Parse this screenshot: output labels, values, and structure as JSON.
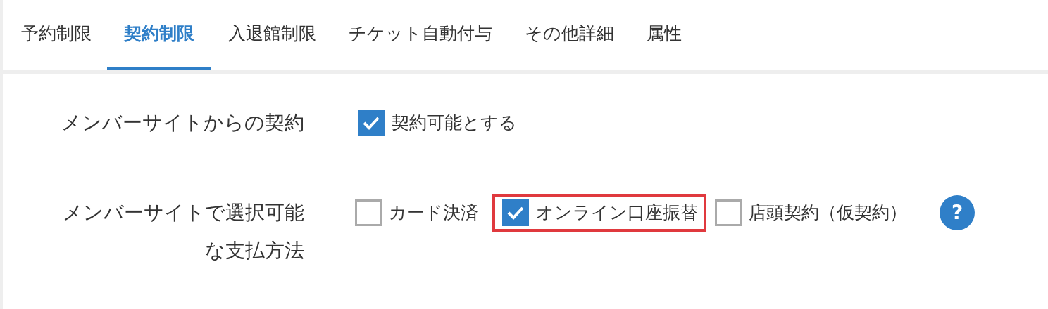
{
  "tabs": [
    {
      "label": "予約制限",
      "selected": false
    },
    {
      "label": "契約制限",
      "selected": true
    },
    {
      "label": "入退館制限",
      "selected": false
    },
    {
      "label": "チケット自動付与",
      "selected": false
    },
    {
      "label": "その他詳細",
      "selected": false
    },
    {
      "label": "属性",
      "selected": false
    }
  ],
  "settings": [
    {
      "label": "メンバーサイトからの契約",
      "options": [
        {
          "label": "契約可能とする",
          "checked": true,
          "highlighted": false
        }
      ],
      "help": false
    },
    {
      "label": "メンバーサイトで選択可能な支払方法",
      "options": [
        {
          "label": "カード決済",
          "checked": false,
          "highlighted": false
        },
        {
          "label": "オンライン口座振替",
          "checked": true,
          "highlighted": true
        },
        {
          "label": "店頭契約（仮契約）",
          "checked": false,
          "highlighted": false
        }
      ],
      "help": true,
      "help_text": "?"
    }
  ]
}
